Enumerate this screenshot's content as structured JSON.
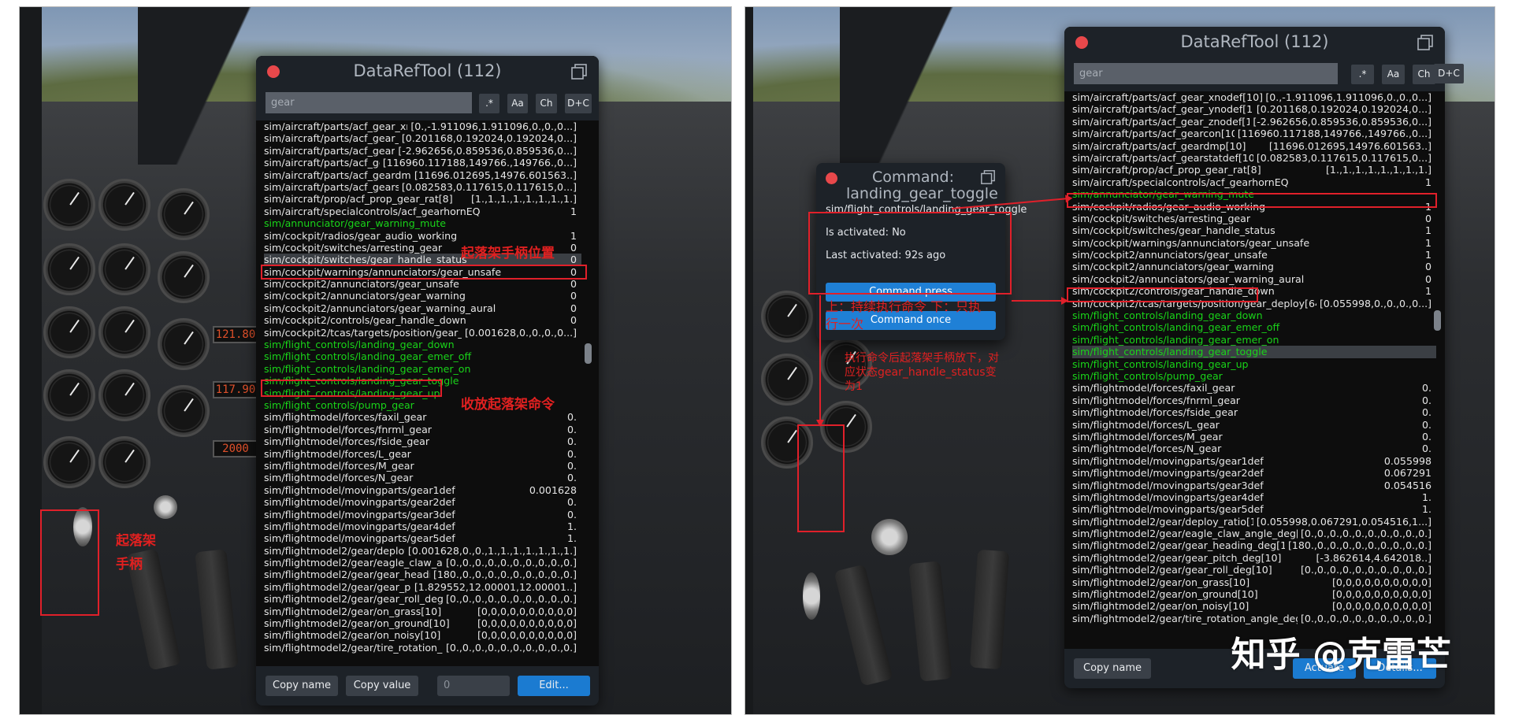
{
  "left": {
    "window": {
      "title": "DataRefTool (112)",
      "search_placeholder": "gear",
      "buttons": [
        ".*",
        "Aa",
        "Ch",
        "D+C"
      ],
      "rows": [
        {
          "n": "sim/aircraft/parts/acf_gear_xnodef[10]",
          "v": "[0.,-1.911096,1.911096,0.,0.,0...]"
        },
        {
          "n": "sim/aircraft/parts/acf_gear_ynodef[10]",
          "v": "[0.201168,0.192024,0.192024,0...]"
        },
        {
          "n": "sim/aircraft/parts/acf_gear_znodef[10]",
          "v": "[-2.962656,0.859536,0.859536,0...]"
        },
        {
          "n": "sim/aircraft/parts/acf_gearcon[10]",
          "v": "[116960.117188,149766.,149766.,0...]"
        },
        {
          "n": "sim/aircraft/parts/acf_geardmp[10]",
          "v": "[11696.012695,14976.601563..]"
        },
        {
          "n": "sim/aircraft/parts/acf_gearstatdef[10]",
          "v": "[0.082583,0.117615,0.117615,0...]"
        },
        {
          "n": "sim/aircraft/prop/acf_prop_gear_rat[8]",
          "v": "[1.,1.,1.,1.,1.,1.,1.,1.]"
        },
        {
          "n": "sim/aircraft/specialcontrols/acf_gearhornEQ",
          "v": "1"
        },
        {
          "n": "sim/annunciator/gear_warning_mute",
          "v": "",
          "c": 1
        },
        {
          "n": "sim/cockpit/radios/gear_audio_working",
          "v": "1"
        },
        {
          "n": "sim/cockpit/switches/arresting_gear",
          "v": "0"
        },
        {
          "n": "sim/cockpit/switches/gear_handle_status",
          "v": "0",
          "s": 1
        },
        {
          "n": "sim/cockpit/warnings/annunciators/gear_unsafe",
          "v": "0"
        },
        {
          "n": "sim/cockpit2/annunciators/gear_unsafe",
          "v": "0"
        },
        {
          "n": "sim/cockpit2/annunciators/gear_warning",
          "v": "0"
        },
        {
          "n": "sim/cockpit2/annunciators/gear_warning_aural",
          "v": "0"
        },
        {
          "n": "sim/cockpit2/controls/gear_handle_down",
          "v": "0"
        },
        {
          "n": "sim/cockpit2/tcas/targets/position/gear_deploy[64]",
          "v": "[0.001628,0.,0.,0.,0...]"
        },
        {
          "n": "sim/flight_controls/landing_gear_down",
          "v": "",
          "c": 1
        },
        {
          "n": "sim/flight_controls/landing_gear_emer_off",
          "v": "",
          "c": 1
        },
        {
          "n": "sim/flight_controls/landing_gear_emer_on",
          "v": "",
          "c": 1
        },
        {
          "n": "sim/flight_controls/landing_gear_toggle",
          "v": "",
          "c": 1
        },
        {
          "n": "sim/flight_controls/landing_gear_up",
          "v": "",
          "c": 1
        },
        {
          "n": "sim/flight_controls/pump_gear",
          "v": "",
          "c": 1
        },
        {
          "n": "sim/flightmodel/forces/faxil_gear",
          "v": "0."
        },
        {
          "n": "sim/flightmodel/forces/fnrml_gear",
          "v": "0."
        },
        {
          "n": "sim/flightmodel/forces/fside_gear",
          "v": "0."
        },
        {
          "n": "sim/flightmodel/forces/L_gear",
          "v": "0."
        },
        {
          "n": "sim/flightmodel/forces/M_gear",
          "v": "0."
        },
        {
          "n": "sim/flightmodel/forces/N_gear",
          "v": "0."
        },
        {
          "n": "sim/flightmodel/movingparts/gear1def",
          "v": "0.001628"
        },
        {
          "n": "sim/flightmodel/movingparts/gear2def",
          "v": "0."
        },
        {
          "n": "sim/flightmodel/movingparts/gear3def",
          "v": "0."
        },
        {
          "n": "sim/flightmodel/movingparts/gear4def",
          "v": "1."
        },
        {
          "n": "sim/flightmodel/movingparts/gear5def",
          "v": "1."
        },
        {
          "n": "sim/flightmodel2/gear/deploy_ratio[10]",
          "v": "[0.001628,0.,0.,1.,1.,1.,1.,1.,1.,1.]"
        },
        {
          "n": "sim/flightmodel2/gear/eagle_claw_angle_deg[10]",
          "v": "[0.,0.,0.,0.,0.,0.,0.,0.,0.,0.]"
        },
        {
          "n": "sim/flightmodel2/gear/gear_heading_deg[10]",
          "v": "[180.,0.,0.,0.,0.,0.,0.,0.,0.,0.]"
        },
        {
          "n": "sim/flightmodel2/gear/gear_pitch_deg[10]",
          "v": "[1.829552,12.00001,12.00001..]"
        },
        {
          "n": "sim/flightmodel2/gear/gear_roll_deg[10]",
          "v": "[0.,0.,0.,0.,0.,0.,0.,0.,0.,0.]"
        },
        {
          "n": "sim/flightmodel2/gear/on_grass[10]",
          "v": "[0,0,0,0,0,0,0,0,0,0]"
        },
        {
          "n": "sim/flightmodel2/gear/on_ground[10]",
          "v": "[0,0,0,0,0,0,0,0,0,0]"
        },
        {
          "n": "sim/flightmodel2/gear/on_noisy[10]",
          "v": "[0,0,0,0,0,0,0,0,0,0]"
        },
        {
          "n": "sim/flightmodel2/gear/tire_rotation_angle_deg[10]",
          "v": "[0.,0.,0.,0.,0.,0.,0.,0.,0.,0.]"
        }
      ],
      "footer": {
        "copy_name": "Copy name",
        "copy_value": "Copy value",
        "value": "0",
        "edit": "Edit..."
      }
    },
    "annotations": {
      "handle_position": "起落架手柄位置",
      "retract_command": "收放起落架命令",
      "gear_handle_line1": "起落架",
      "gear_handle_line2": "手柄"
    }
  },
  "right": {
    "window": {
      "title": "DataRefTool (112)",
      "search_placeholder": "gear",
      "buttons": [
        ".*",
        "Aa",
        "Ch",
        "D+C"
      ],
      "rows": [
        {
          "n": "sim/aircraft/parts/acf_gear_xnodef[10]",
          "v": "[0.,-1.911096,1.911096,0.,0.,0...]"
        },
        {
          "n": "sim/aircraft/parts/acf_gear_ynodef[10]",
          "v": "[0.201168,0.192024,0.192024,0...]"
        },
        {
          "n": "sim/aircraft/parts/acf_gear_znodef[10]",
          "v": "[-2.962656,0.859536,0.859536,0...]"
        },
        {
          "n": "sim/aircraft/parts/acf_gearcon[10]",
          "v": "[116960.117188,149766.,149766.,0...]"
        },
        {
          "n": "sim/aircraft/parts/acf_geardmp[10]",
          "v": "[11696.012695,14976.601563..]"
        },
        {
          "n": "sim/aircraft/parts/acf_gearstatdef[10]",
          "v": "[0.082583,0.117615,0.117615,0...]"
        },
        {
          "n": "sim/aircraft/prop/acf_prop_gear_rat[8]",
          "v": "[1.,1.,1.,1.,1.,1.,1.,1.]"
        },
        {
          "n": "sim/aircraft/specialcontrols/acf_gearhornEQ",
          "v": "1"
        },
        {
          "n": "sim/annunciator/gear_warning_mute",
          "v": "",
          "c": 1
        },
        {
          "n": "sim/cockpit/radios/gear_audio_working",
          "v": "1"
        },
        {
          "n": "sim/cockpit/switches/arresting_gear",
          "v": "0"
        },
        {
          "n": "sim/cockpit/switches/gear_handle_status",
          "v": "1"
        },
        {
          "n": "sim/cockpit/warnings/annunciators/gear_unsafe",
          "v": "1"
        },
        {
          "n": "sim/cockpit2/annunciators/gear_unsafe",
          "v": "1"
        },
        {
          "n": "sim/cockpit2/annunciators/gear_warning",
          "v": "0"
        },
        {
          "n": "sim/cockpit2/annunciators/gear_warning_aural",
          "v": "0"
        },
        {
          "n": "sim/cockpit2/controls/gear_handle_down",
          "v": "1"
        },
        {
          "n": "sim/cockpit2/tcas/targets/position/gear_deploy[64]",
          "v": "[0.055998,0.,0.,0.,0...]"
        },
        {
          "n": "sim/flight_controls/landing_gear_down",
          "v": "",
          "c": 1
        },
        {
          "n": "sim/flight_controls/landing_gear_emer_off",
          "v": "",
          "c": 1
        },
        {
          "n": "sim/flight_controls/landing_gear_emer_on",
          "v": "",
          "c": 1
        },
        {
          "n": "sim/flight_controls/landing_gear_toggle",
          "v": "",
          "c": 1,
          "s": 1
        },
        {
          "n": "sim/flight_controls/landing_gear_up",
          "v": "",
          "c": 1
        },
        {
          "n": "sim/flight_controls/pump_gear",
          "v": "",
          "c": 1
        },
        {
          "n": "sim/flightmodel/forces/faxil_gear",
          "v": "0."
        },
        {
          "n": "sim/flightmodel/forces/fnrml_gear",
          "v": "0."
        },
        {
          "n": "sim/flightmodel/forces/fside_gear",
          "v": "0."
        },
        {
          "n": "sim/flightmodel/forces/L_gear",
          "v": "0."
        },
        {
          "n": "sim/flightmodel/forces/M_gear",
          "v": "0."
        },
        {
          "n": "sim/flightmodel/forces/N_gear",
          "v": "0."
        },
        {
          "n": "sim/flightmodel/movingparts/gear1def",
          "v": "0.055998"
        },
        {
          "n": "sim/flightmodel/movingparts/gear2def",
          "v": "0.067291"
        },
        {
          "n": "sim/flightmodel/movingparts/gear3def",
          "v": "0.054516"
        },
        {
          "n": "sim/flightmodel/movingparts/gear4def",
          "v": "1."
        },
        {
          "n": "sim/flightmodel/movingparts/gear5def",
          "v": "1."
        },
        {
          "n": "sim/flightmodel2/gear/deploy_ratio[10]",
          "v": "[0.055998,0.067291,0.054516,1...]"
        },
        {
          "n": "sim/flightmodel2/gear/eagle_claw_angle_deg[10]",
          "v": "[0.,0.,0.,0.,0.,0.,0.,0.,0.,0.]"
        },
        {
          "n": "sim/flightmodel2/gear/gear_heading_deg[10]",
          "v": "[180.,0.,0.,0.,0.,0.,0.,0.,0.,0.]"
        },
        {
          "n": "sim/flightmodel2/gear/gear_pitch_deg[10]",
          "v": "[-3.862614,4.642018..]"
        },
        {
          "n": "sim/flightmodel2/gear/gear_roll_deg[10]",
          "v": "[0.,0.,0.,0.,0.,0.,0.,0.,0.,0.]"
        },
        {
          "n": "sim/flightmodel2/gear/on_grass[10]",
          "v": "[0,0,0,0,0,0,0,0,0,0]"
        },
        {
          "n": "sim/flightmodel2/gear/on_ground[10]",
          "v": "[0,0,0,0,0,0,0,0,0,0]"
        },
        {
          "n": "sim/flightmodel2/gear/on_noisy[10]",
          "v": "[0,0,0,0,0,0,0,0,0,0]"
        },
        {
          "n": "sim/flightmodel2/gear/tire_rotation_angle_deg[10]",
          "v": "[0.,0.,0.,0.,0.,0.,0.,0.,0.,0.]"
        }
      ],
      "footer": {
        "copy_name": "Copy name",
        "actuate": "Actuate",
        "details": "Details..."
      }
    },
    "command_window": {
      "title": "Command: landing_gear_toggle",
      "name": "sim/flight_controls/landing_gear_toggle",
      "activated": "Is activated: No",
      "last_activated": "Last activated: 92s ago",
      "press": "Command press",
      "once": "Command once"
    },
    "annotations": {
      "press_once_note": "上：持续执行命令 下：只执行一次",
      "result_note": "执行命令后起落架手柄放下，对应状态gear_handle_status变为1"
    },
    "watermark": "知乎 @克雷芒"
  },
  "colors": {
    "command_green": "#19d419",
    "close_red": "#e8484b",
    "accent_blue": "#1b7bd1",
    "annotation_red": "#e02020"
  }
}
